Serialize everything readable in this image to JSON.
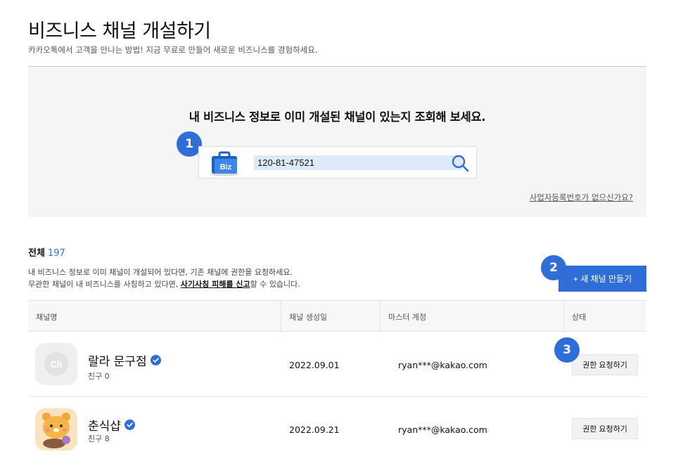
{
  "header": {
    "title": "비즈니스 채널 개설하기",
    "subtitle": "카카오톡에서 고객을 만나는 방법! 지금 무료로 만들어 새로운 비즈니스를 경험하세요."
  },
  "lookup": {
    "heading": "내 비즈니스 정보로 이미 개설된 채널이 있는지 조회해 보세요.",
    "step_number": "1",
    "biz_badge": "Biz",
    "search_value": "120-81-47521",
    "no_registration_link": "사업자등록번호가 없으신가요?"
  },
  "results": {
    "total_label": "전체",
    "total_count": "197",
    "notice_line1": "내 비즈니스 정보로 이미 채널이 개설되어 있다면, 기존 채널에 권한을 요청하세요.",
    "notice_line2_prefix": "무관한 채널이 내 비즈니스를 사칭하고 있다면, ",
    "notice_line2_link": "사기사칭 피해를 신고",
    "notice_line2_suffix": "할 수 있습니다.",
    "create_step_number": "2",
    "create_button": "+ 새 채널 만들기",
    "request_step_number": "3"
  },
  "table": {
    "columns": [
      "채널명",
      "채널 생성일",
      "마스터 계정",
      "상태"
    ],
    "rows": [
      {
        "name": "랄라 문구점",
        "friends": "친구 0",
        "avatar_text": "Ch",
        "created": "2022.09.01",
        "master": "ryan***@kakao.com",
        "action": "권한 요청하기"
      },
      {
        "name": "춘식샵",
        "friends": "친구 8",
        "created": "2022.09.21",
        "master": "ryan***@kakao.com",
        "action": "권한 요청하기"
      }
    ]
  },
  "colors": {
    "accent": "#2e6ed6",
    "panel_bg": "#f5f5f5",
    "input_highlight": "#ddeafc"
  },
  "icons": {
    "biz": "briefcase-icon",
    "search": "search-icon",
    "verified": "verified-badge-icon"
  }
}
